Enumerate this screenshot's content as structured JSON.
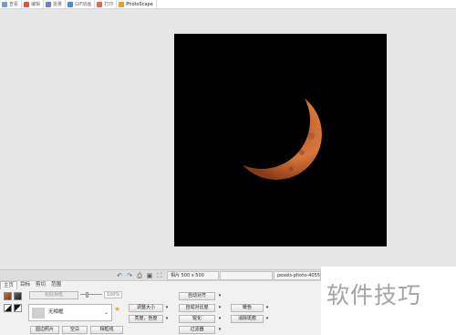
{
  "toolbar": {
    "items": [
      {
        "label": "查看",
        "icon": "view-icon",
        "color": "#7d9ac0"
      },
      {
        "label": "编辑",
        "icon": "editor-icon",
        "color": "#d0574a"
      },
      {
        "label": "批量",
        "icon": "batch-icon",
        "color": "#6f7fc4"
      },
      {
        "label": "GIF动画",
        "icon": "gif-icon",
        "color": "#4a8bd0"
      },
      {
        "label": "打印",
        "icon": "print-icon",
        "color": "#d96a5a"
      },
      {
        "label": "PhotoScape",
        "icon": "photoscape-icon",
        "color": "#e0a030"
      }
    ]
  },
  "photo": {
    "background": "#000000",
    "moon_color": "#c8662a"
  },
  "statusbar": {
    "size": "相片 500 x 500",
    "filename": "pexels-photo-4055",
    "icons": [
      "rotate-left-icon",
      "rotate-right-icon",
      "print-icon",
      "save-icon",
      "fullscreen-icon"
    ]
  },
  "tabs": [
    "主页",
    "目标",
    "剪切",
    "范围"
  ],
  "home": {
    "clipboard_button": "粘贴相框",
    "slider_percent": "100%",
    "frame_label": "无相框",
    "round_photo": "圆边照片",
    "blank": "空白",
    "photo_frame": "相框线",
    "resize": "调整大小",
    "brightness": "亮度，色度",
    "auto_level": "自动对齐",
    "auto_contrast": "自动对比度",
    "sharpen": "锐化",
    "filter": "过滤器",
    "backlight": "暖色",
    "deblur": "消除斑痕"
  },
  "watermark": "软件技巧"
}
